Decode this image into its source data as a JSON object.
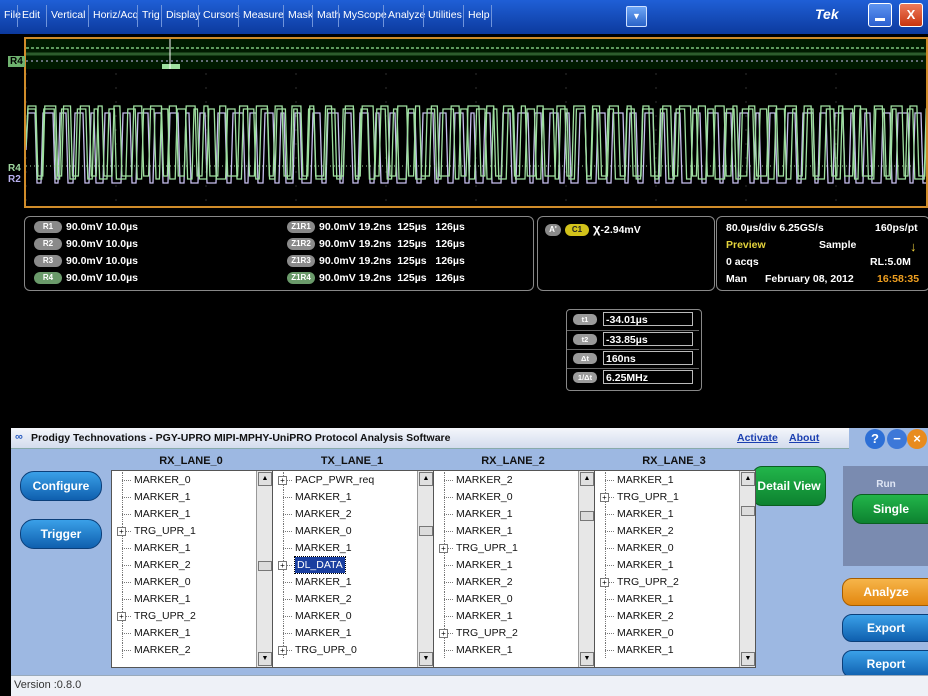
{
  "menu": {
    "items": [
      "File",
      "Edit",
      "Vertical",
      "Horiz/Acq",
      "Trig",
      "Display",
      "Cursors",
      "Measure",
      "Mask",
      "Math",
      "MyScope",
      "Analyze",
      "Utilities",
      "Help"
    ],
    "brand": "Tek",
    "dropdown_icon": "chevron-down-icon",
    "close_label": "X"
  },
  "waveform": {
    "labels": {
      "r4_top": "R4",
      "r4_bottom": "R4",
      "r2": "R2"
    },
    "trace_colors": {
      "green": "#9fe0a0",
      "lavender": "#c8c0f0",
      "orange": "#d08c2a"
    }
  },
  "readouts": {
    "refs": [
      {
        "badge": "R1",
        "text": "90.0mV 10.0µs"
      },
      {
        "badge": "R2",
        "text": "90.0mV 10.0µs"
      },
      {
        "badge": "R3",
        "text": "90.0mV 10.0µs"
      },
      {
        "badge": "R4",
        "text": "90.0mV 10.0µs"
      }
    ],
    "zooms": [
      {
        "badge": "Z1R1",
        "text": "90.0mV 19.2ns  125µs   126µs"
      },
      {
        "badge": "Z1R2",
        "text": "90.0mV 19.2ns  125µs   126µs"
      },
      {
        "badge": "Z1R3",
        "text": "90.0mV 19.2ns  125µs   126µs"
      },
      {
        "badge": "Z1R4",
        "text": "90.0mV 19.2ns  125µs   126µs"
      }
    ],
    "trigger": {
      "a_badge": "A'",
      "c1_badge": "C1",
      "value": "-2.94mV"
    },
    "acq": {
      "timebase": "80.0µs/div 6.25GS/s",
      "resolution": "160ps/pt",
      "mode": "Preview",
      "sample": "Sample",
      "acqs": "0 acqs",
      "rl": "RL:5.0M",
      "man": "Man",
      "date": "February 08, 2012",
      "time": "16:58:35"
    },
    "cursors": [
      {
        "badge": "t1",
        "value": "-34.01µs"
      },
      {
        "badge": "t2",
        "value": "-33.85µs"
      },
      {
        "badge": "Δt",
        "value": "160ns"
      },
      {
        "badge": "1/Δt",
        "value": "6.25MHz"
      }
    ]
  },
  "panel": {
    "title": "Prodigy Technovations - PGY-UPRO MIPI-MPHY-UniPRO Protocol Analysis Software",
    "activate": "Activate",
    "about": "About",
    "help_label": "?",
    "configure": "Configure",
    "trigger": "Trigger",
    "detail_view": "Detail View",
    "run": "Run",
    "single": "Single",
    "analyze": "Analyze",
    "export": "Export",
    "report": "Report",
    "version": "Version :0.8.0",
    "lanes": [
      {
        "title": "RX_LANE_0",
        "rows": [
          {
            "t": "MARKER_0",
            "exp": false
          },
          {
            "t": "MARKER_1",
            "exp": false
          },
          {
            "t": "MARKER_1",
            "exp": false
          },
          {
            "t": "TRG_UPR_1",
            "exp": true
          },
          {
            "t": "MARKER_1",
            "exp": false
          },
          {
            "t": "MARKER_2",
            "exp": false
          },
          {
            "t": "MARKER_0",
            "exp": false
          },
          {
            "t": "MARKER_1",
            "exp": false
          },
          {
            "t": "TRG_UPR_2",
            "exp": true
          },
          {
            "t": "MARKER_1",
            "exp": false
          },
          {
            "t": "MARKER_2",
            "exp": false
          }
        ]
      },
      {
        "title": "TX_LANE_1",
        "rows": [
          {
            "t": "PACP_PWR_req",
            "exp": true
          },
          {
            "t": "MARKER_1",
            "exp": false
          },
          {
            "t": "MARKER_2",
            "exp": false
          },
          {
            "t": "MARKER_0",
            "exp": false
          },
          {
            "t": "MARKER_1",
            "exp": false
          },
          {
            "t": "DL_DATA",
            "exp": true,
            "sel": true
          },
          {
            "t": "MARKER_1",
            "exp": false
          },
          {
            "t": "MARKER_2",
            "exp": false
          },
          {
            "t": "MARKER_0",
            "exp": false
          },
          {
            "t": "MARKER_1",
            "exp": false
          },
          {
            "t": "TRG_UPR_0",
            "exp": true
          }
        ]
      },
      {
        "title": "RX_LANE_2",
        "rows": [
          {
            "t": "MARKER_2",
            "exp": false
          },
          {
            "t": "MARKER_0",
            "exp": false
          },
          {
            "t": "MARKER_1",
            "exp": false
          },
          {
            "t": "MARKER_1",
            "exp": false
          },
          {
            "t": "TRG_UPR_1",
            "exp": true
          },
          {
            "t": "MARKER_1",
            "exp": false
          },
          {
            "t": "MARKER_2",
            "exp": false
          },
          {
            "t": "MARKER_0",
            "exp": false
          },
          {
            "t": "MARKER_1",
            "exp": false
          },
          {
            "t": "TRG_UPR_2",
            "exp": true
          },
          {
            "t": "MARKER_1",
            "exp": false
          }
        ]
      },
      {
        "title": "RX_LANE_3",
        "rows": [
          {
            "t": "MARKER_1",
            "exp": false
          },
          {
            "t": "TRG_UPR_1",
            "exp": true
          },
          {
            "t": "MARKER_1",
            "exp": false
          },
          {
            "t": "MARKER_2",
            "exp": false
          },
          {
            "t": "MARKER_0",
            "exp": false
          },
          {
            "t": "MARKER_1",
            "exp": false
          },
          {
            "t": "TRG_UPR_2",
            "exp": true
          },
          {
            "t": "MARKER_1",
            "exp": false
          },
          {
            "t": "MARKER_2",
            "exp": false
          },
          {
            "t": "MARKER_0",
            "exp": false
          },
          {
            "t": "MARKER_1",
            "exp": false
          }
        ]
      }
    ]
  }
}
